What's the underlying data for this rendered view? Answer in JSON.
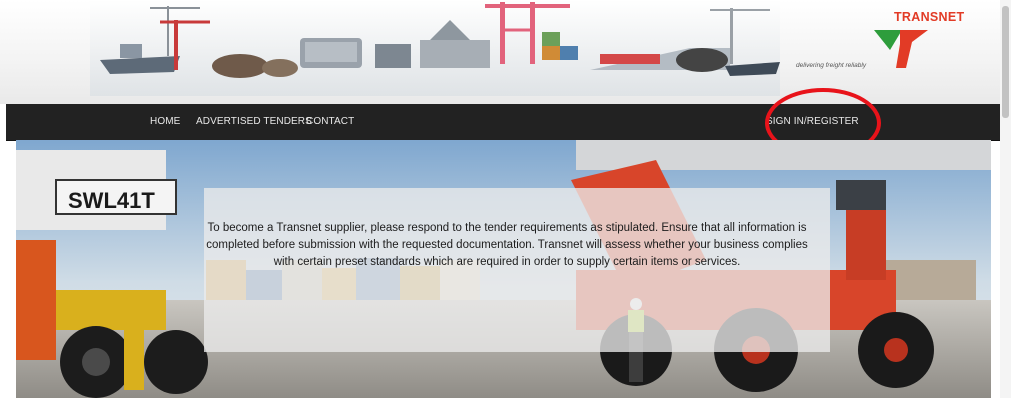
{
  "brand": {
    "logo_text": "TRANSNET",
    "tagline": "delivering freight reliably",
    "accent": "#e23b26",
    "green": "#2e9d3c"
  },
  "nav": {
    "home": "HOME",
    "tenders": "ADVERTISED TENDERS",
    "contact": "CONTACT",
    "signin": "SIGN IN/REGISTER",
    "highlight_color": "#e8131a"
  },
  "hero": {
    "text": "To become a Transnet supplier, please respond to the tender requirements as stipulated. Ensure that all information is completed before submission with the requested documentation. Transnet will assess whether your business complies with certain preset standards which are required in order to supply certain items or services.",
    "machine_label": "SWL41T"
  }
}
